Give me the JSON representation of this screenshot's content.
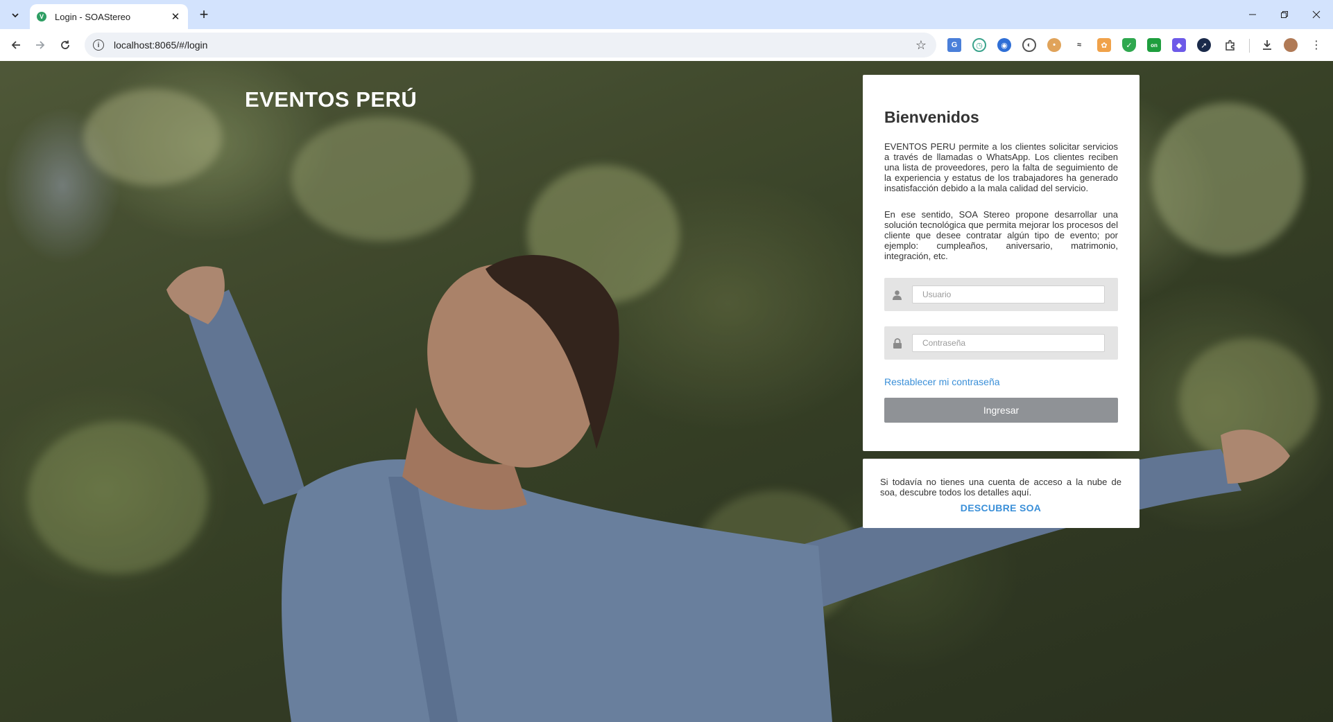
{
  "browser": {
    "tab_title": "Login - SOAStereo",
    "url": "localhost:8065/#/login",
    "favicon_icon": "vue-icon",
    "new_tab": "+",
    "extensions": [
      "translate-icon",
      "clock-icon",
      "eye-icon",
      "record-icon",
      "cookie-icon",
      "shoe-icon",
      "puzzle-fox-icon",
      "shield-icon",
      "on-icon",
      "diamond-icon",
      "rocket-icon",
      "puzzle-icon"
    ]
  },
  "page": {
    "brand": "EVENTOS PERÚ",
    "login_card": {
      "title": "Bienvenidos",
      "paragraph1": "EVENTOS PERU permite a los clientes solicitar servicios a través de llamadas o WhatsApp. Los clientes reciben una lista de proveedores, pero la falta de seguimiento de la experiencia y estatus de los trabajadores ha generado insatisfacción debido a la mala calidad del servicio.",
      "paragraph2": "En ese sentido, SOA Stereo propone desarrollar una solución tecnológica que permita mejorar los procesos del cliente que desee contratar algún tipo de evento; por ejemplo: cumpleaños, aniversario, matrimonio, integración, etc.",
      "username_placeholder": "Usuario",
      "username_value": "",
      "password_placeholder": "Contraseña",
      "password_value": "",
      "reset_link": "Restablecer mi contraseña",
      "submit_label": "Ingresar"
    },
    "signup_card": {
      "text": "Si todavía no tienes una cuenta de acceso a la nube de soa, descubre todos los detalles aquí.",
      "link": "DESCUBRE SOA"
    }
  },
  "colors": {
    "link": "#3a8fd8",
    "button_bg": "#8f9296",
    "tabstrip": "#d3e3fd"
  }
}
